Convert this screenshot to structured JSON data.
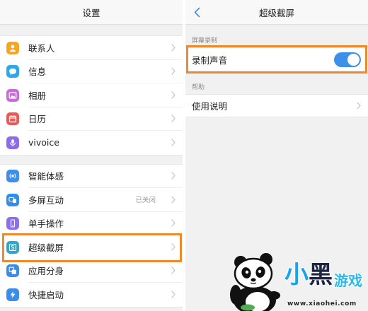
{
  "left_screen": {
    "title": "设置",
    "groups": [
      {
        "items": [
          {
            "label": "联系人",
            "icon": "contacts-icon",
            "icon_color": "#f6a623"
          },
          {
            "label": "信息",
            "icon": "messages-icon",
            "icon_color": "#2ca7ea"
          },
          {
            "label": "相册",
            "icon": "album-icon",
            "icon_color": "#c76cd8"
          },
          {
            "label": "日历",
            "icon": "calendar-icon",
            "icon_color": "#f25552"
          },
          {
            "label": "vivoice",
            "icon": "microphone-icon",
            "icon_color": "#8c6ce9"
          }
        ]
      },
      {
        "items": [
          {
            "label": "智能体感",
            "icon": "motion-sense-icon",
            "icon_color": "#3f8fe8"
          },
          {
            "label": "多屏互动",
            "icon": "multi-screen-icon",
            "icon_color": "#2f8fe9",
            "value": "已关闭"
          },
          {
            "label": "单手操作",
            "icon": "one-hand-icon",
            "icon_color": "#8c70ea"
          },
          {
            "label": "超级截屏",
            "icon": "super-screenshot-icon",
            "icon_color": "#33a5c8",
            "highlighted": true
          },
          {
            "label": "应用分身",
            "icon": "app-clone-icon",
            "icon_color": "#3a8ce7"
          },
          {
            "label": "快捷启动",
            "icon": "quick-launch-icon",
            "icon_color": "#3b8de7"
          }
        ]
      }
    ]
  },
  "right_screen": {
    "title": "超级截屏",
    "back_icon": "chevron-left-icon",
    "sections": [
      {
        "header": "屏幕录制",
        "rows": [
          {
            "label": "录制声音",
            "toggle_on": true,
            "highlighted": true
          }
        ]
      },
      {
        "header": "帮助",
        "rows": [
          {
            "label": "使用说明"
          }
        ]
      }
    ]
  },
  "colors": {
    "highlight": "#ee8a2b",
    "accent": "#3d8fe9"
  },
  "watermark": {
    "brand_parts": [
      "小",
      "黑",
      "游戏"
    ],
    "url": "www.xiaohei.com"
  }
}
